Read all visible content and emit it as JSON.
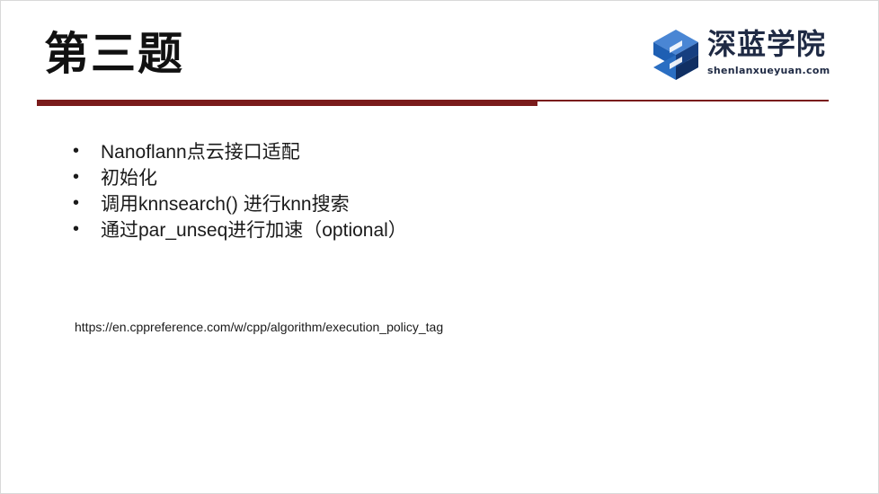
{
  "slide": {
    "title": "第三题",
    "logo": {
      "name_cn": "深蓝学院",
      "name_en": "shenlanxueyuan.com",
      "icon": "shenlan-logo-icon"
    },
    "bullets": [
      "Nanoflann点云接口适配",
      "初始化",
      "调用knnsearch() 进行knn搜索",
      "通过par_unseq进行加速（optional）"
    ],
    "bullet_symbol": "•",
    "reference_url": "https://en.cppreference.com/w/cpp/algorithm/execution_policy_tag"
  },
  "colors": {
    "accent_dark_red": "#7a1b1b",
    "logo_blue": "#1e5fb3",
    "logo_dark": "#1f2a44",
    "text": "#1a1a1a"
  }
}
